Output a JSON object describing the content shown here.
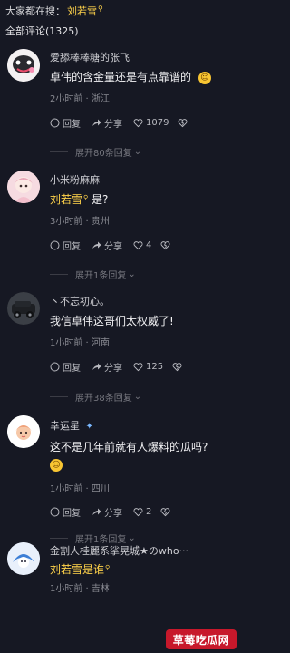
{
  "top_search": {
    "prefix": "大家都在搜：",
    "keyword": "刘若雪"
  },
  "comment_count_label": "全部评论(1325)",
  "comments": [
    {
      "username": "爱舔棒棒糖的张飞",
      "text": "卓伟的含金量还是有点靠谱的",
      "meta": "2小时前 · 浙江",
      "reply": "回复",
      "share": "分享",
      "likes": "1079",
      "expand": "展开80条回复"
    },
    {
      "username": "小米粉麻麻",
      "text_keyword": "刘若雪",
      "text": "是?",
      "meta": "3小时前 · 贵州",
      "reply": "回复",
      "share": "分享",
      "likes": "4",
      "expand": "展开1条回复"
    },
    {
      "username": "丶不忘初心。",
      "text": "我信卓伟这哥们太权威了!",
      "meta": "1小时前 · 河南",
      "reply": "回复",
      "share": "分享",
      "likes": "125",
      "expand": "展开38条回复"
    },
    {
      "username": "幸运星",
      "text": "这不是几年前就有人爆料的瓜吗?",
      "meta": "1小时前 · 四川",
      "reply": "回复",
      "share": "分享",
      "likes": "2",
      "expand": "展开1条回复"
    },
    {
      "username": "金割人桂麗系挲晃城★のwho···",
      "text_keyword": "刘若雪是谁",
      "meta": "1小时前 · 吉林"
    }
  ],
  "watermark": "草莓吃瓜网",
  "colors": {
    "background": "#161823",
    "keyword": "#ffd24a",
    "muted": "#8a8b93"
  }
}
